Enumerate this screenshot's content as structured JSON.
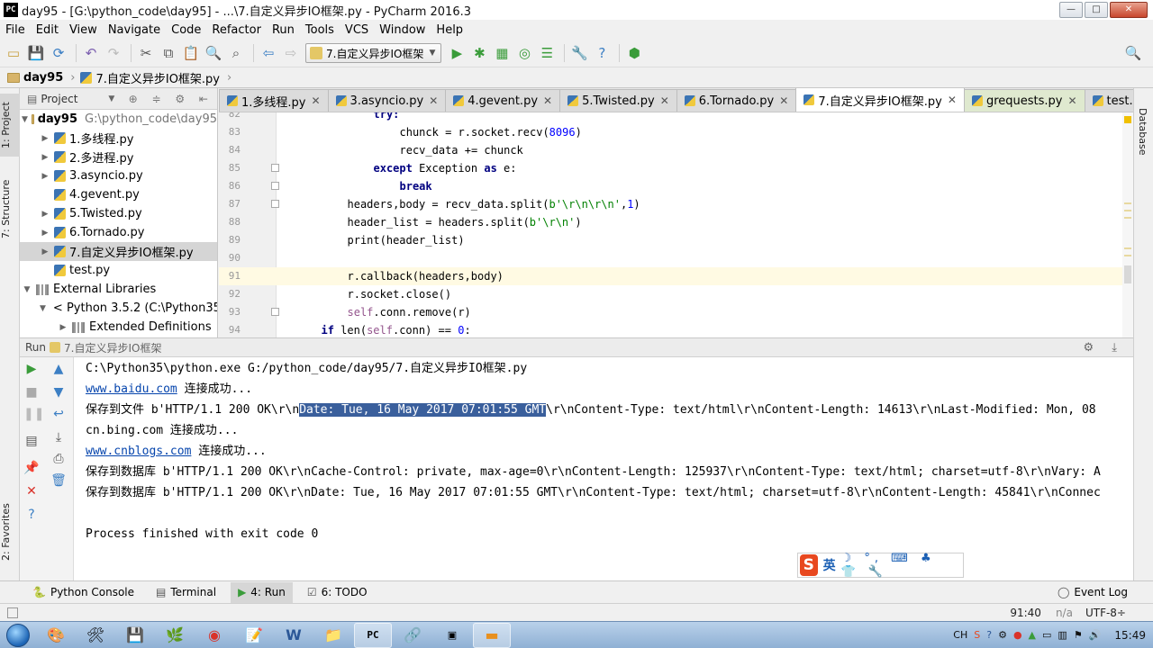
{
  "window": {
    "title": "day95 - [G:\\python_code\\day95] - ...\\7.自定义异步IO框架.py - PyCharm 2016.3",
    "app_icon": "PC",
    "controls": {
      "minimize": "—",
      "maximize": "□",
      "close": "✕"
    }
  },
  "menu": [
    "File",
    "Edit",
    "View",
    "Navigate",
    "Code",
    "Refactor",
    "Run",
    "Tools",
    "VCS",
    "Window",
    "Help"
  ],
  "toolbar": {
    "run_config": "7.自定义异步IO框架",
    "run_config_caret": "▼"
  },
  "navbar": {
    "crumbs": [
      "day95",
      "7.自定义异步IO框架.py"
    ],
    "separator": "›"
  },
  "left_strip": {
    "project_tab": "1: Project",
    "structure_tab": "7: Structure",
    "favorites_tab": "2: Favorites"
  },
  "right_strip": {
    "database_tab": "Database"
  },
  "project_panel": {
    "title": "Project",
    "header_icons": "⊕ ≑ ⚙ ⇤",
    "root": {
      "name": "day95",
      "path": "G:\\python_code\\day95"
    },
    "items": [
      {
        "name": "1.多线程.py",
        "expandable": true
      },
      {
        "name": "2.多进程.py",
        "expandable": true
      },
      {
        "name": "3.asyncio.py",
        "expandable": true
      },
      {
        "name": "4.gevent.py",
        "expandable": false
      },
      {
        "name": "5.Twisted.py",
        "expandable": true
      },
      {
        "name": "6.Tornado.py",
        "expandable": true
      },
      {
        "name": "7.自定义异步IO框架.py",
        "expandable": true,
        "selected": true
      },
      {
        "name": "test.py",
        "expandable": false
      }
    ],
    "external_libraries": "External Libraries",
    "python_sdk": "< Python 3.5.2 (C:\\Python35",
    "extended_definitions": "Extended Definitions"
  },
  "editor": {
    "tabs": [
      {
        "label": "1.多线程.py",
        "active": false
      },
      {
        "label": "3.asyncio.py",
        "active": false
      },
      {
        "label": "4.gevent.py",
        "active": false
      },
      {
        "label": "5.Twisted.py",
        "active": false
      },
      {
        "label": "6.Tornado.py",
        "active": false
      },
      {
        "label": "7.自定义异步IO框架.py",
        "active": true
      },
      {
        "label": "grequests.py",
        "active": false
      },
      {
        "label": "test.py",
        "active": false
      }
    ],
    "tab_overflow": "≡1",
    "lines": [
      {
        "n": "82",
        "indent": 7,
        "segments": [
          {
            "t": "try:",
            "c": "kw"
          }
        ]
      },
      {
        "n": "83",
        "indent": 9,
        "segments": [
          {
            "t": "chunck = r.socket.recv(",
            "c": ""
          },
          {
            "t": "8096",
            "c": "num"
          },
          {
            "t": ")",
            "c": ""
          }
        ]
      },
      {
        "n": "84",
        "indent": 9,
        "segments": [
          {
            "t": "recv_data += chunck",
            "c": ""
          }
        ]
      },
      {
        "n": "85",
        "indent": 7,
        "segments": [
          {
            "t": "except",
            "c": "kw"
          },
          {
            "t": " Exception ",
            "c": ""
          },
          {
            "t": "as",
            "c": "kw"
          },
          {
            "t": " e:",
            "c": ""
          }
        ]
      },
      {
        "n": "86",
        "indent": 9,
        "segments": [
          {
            "t": "break",
            "c": "kw"
          }
        ]
      },
      {
        "n": "87",
        "indent": 5,
        "segments": [
          {
            "t": "headers,body = recv_data.split(",
            "c": ""
          },
          {
            "t": "b'\\r\\n\\r\\n'",
            "c": "str"
          },
          {
            "t": ",",
            "c": ""
          },
          {
            "t": "1",
            "c": "num"
          },
          {
            "t": ")",
            "c": ""
          }
        ]
      },
      {
        "n": "88",
        "indent": 5,
        "segments": [
          {
            "t": "header_list = headers.split(",
            "c": ""
          },
          {
            "t": "b'\\r\\n'",
            "c": "str"
          },
          {
            "t": ")",
            "c": ""
          }
        ]
      },
      {
        "n": "89",
        "indent": 5,
        "segments": [
          {
            "t": "print(header_list)",
            "c": ""
          }
        ]
      },
      {
        "n": "90",
        "indent": 0,
        "segments": [
          {
            "t": "",
            "c": ""
          }
        ]
      },
      {
        "n": "91",
        "indent": 5,
        "current": true,
        "segments": [
          {
            "t": "r.callback(headers,body)",
            "c": ""
          }
        ]
      },
      {
        "n": "92",
        "indent": 5,
        "segments": [
          {
            "t": "r.socket.close()",
            "c": ""
          }
        ]
      },
      {
        "n": "93",
        "indent": 5,
        "segments": [
          {
            "t": "self",
            "c": "selfkw"
          },
          {
            "t": ".conn.remove(r)",
            "c": ""
          }
        ]
      },
      {
        "n": "94",
        "indent": 3,
        "segments": [
          {
            "t": "if",
            "c": "kw"
          },
          {
            "t": " len(",
            "c": ""
          },
          {
            "t": "self",
            "c": "selfkw"
          },
          {
            "t": ".conn) == ",
            "c": ""
          },
          {
            "t": "0",
            "c": "num"
          },
          {
            "t": ":",
            "c": ""
          }
        ]
      }
    ]
  },
  "run_panel": {
    "title": "Run",
    "file": "7.自定义异步IO框架",
    "header_icons": "⚙ ⤓",
    "console": [
      {
        "parts": [
          {
            "t": "C:\\Python35\\python.exe G:/python_code/day95/7.自定义异步IO框架.py",
            "k": "text"
          }
        ]
      },
      {
        "parts": [
          {
            "t": "www.baidu.com",
            "k": "link"
          },
          {
            "t": " 连接成功...",
            "k": "text"
          }
        ]
      },
      {
        "parts": [
          {
            "t": "保存到文件 b'HTTP/1.1 200 OK\\r\\n",
            "k": "text"
          },
          {
            "t": "Date: Tue, 16 May 2017 07:01:55 GMT",
            "k": "sel"
          },
          {
            "t": "\\r\\nContent-Type: text/html\\r\\nContent-Length: 14613\\r\\nLast-Modified: Mon, 08",
            "k": "text"
          }
        ]
      },
      {
        "parts": [
          {
            "t": "cn.bing.com 连接成功...",
            "k": "text"
          }
        ]
      },
      {
        "parts": [
          {
            "t": "www.cnblogs.com",
            "k": "link"
          },
          {
            "t": " 连接成功...",
            "k": "text"
          }
        ]
      },
      {
        "parts": [
          {
            "t": "保存到数据库 b'HTTP/1.1 200 OK\\r\\nCache-Control: private, max-age=0\\r\\nContent-Length: 125937\\r\\nContent-Type: text/html; charset=utf-8\\r\\nVary: A",
            "k": "text"
          }
        ]
      },
      {
        "parts": [
          {
            "t": "保存到数据库 b'HTTP/1.1 200 OK\\r\\nDate: Tue, 16 May 2017 07:01:55 GMT\\r\\nContent-Type: text/html; charset=utf-8\\r\\nContent-Length: 45841\\r\\nConnec",
            "k": "text"
          }
        ]
      },
      {
        "parts": [
          {
            "t": "",
            "k": "text"
          }
        ]
      },
      {
        "parts": [
          {
            "t": "Process finished with exit code 0",
            "k": "text"
          }
        ]
      }
    ]
  },
  "ime": {
    "logo": "S",
    "lang": "英",
    "icons": "☽ °, ⌨ ♣ 👕 🔧"
  },
  "toolwindows": {
    "python_console": "Python Console",
    "terminal": "Terminal",
    "run": "4: Run",
    "todo": "6: TODO",
    "event_log": "Event Log"
  },
  "status": {
    "position": "91:40",
    "na": "n/a",
    "encoding": "UTF-8÷"
  },
  "taskbar": {
    "tray_lang": "CH",
    "clock": "15:49"
  }
}
